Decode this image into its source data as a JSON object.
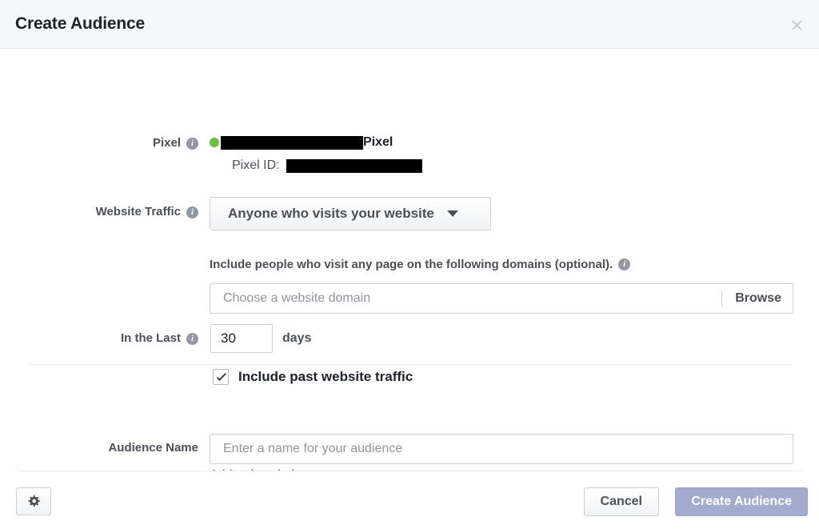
{
  "dialog": {
    "title": "Create Audience",
    "close_icon": "close-icon"
  },
  "pixel": {
    "label": "Pixel",
    "status": "active",
    "status_color": "#6abf3f",
    "name_redacted": true,
    "name_suffix": "Pixel",
    "id_label": "Pixel ID:",
    "id_redacted": true
  },
  "website_traffic": {
    "label": "Website Traffic",
    "selected_option": "Anyone who visits your website",
    "options": [
      "Anyone who visits your website"
    ],
    "caret_icon": "chevron-down-icon"
  },
  "domains": {
    "help_text": "Include people who visit any page on the following domains (optional).",
    "input_value": "",
    "input_placeholder": "Choose a website domain",
    "browse_label": "Browse"
  },
  "retention": {
    "label": "In the Last",
    "days_value": "30",
    "days_unit": "days"
  },
  "past_traffic": {
    "label": "Include past website traffic",
    "checked": true
  },
  "audience_name": {
    "label": "Audience Name",
    "input_value": "",
    "input_placeholder": "Enter a name for your audience",
    "add_description_label": "Add a description",
    "link_color": "#3b5998"
  },
  "footer": {
    "settings_icon": "gear-icon",
    "cancel_label": "Cancel",
    "create_label": "Create Audience",
    "create_disabled": true,
    "create_color": "#a3abcf"
  }
}
